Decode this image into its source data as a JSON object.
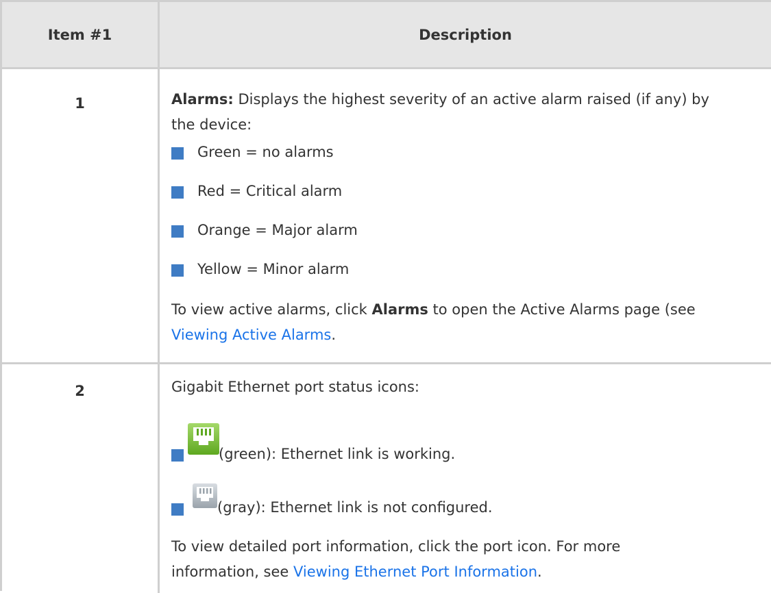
{
  "table": {
    "headers": [
      "Item #1",
      "Description"
    ],
    "rows": [
      {
        "item": "1",
        "intro_bold": "Alarms:",
        "intro_line1": " Displays the highest severity of an active alarm raised (if any) by",
        "intro_line2": "the device:",
        "bullets": [
          "Green = no alarms",
          "Red = Critical alarm",
          "Orange = Major alarm",
          "Yellow = Minor alarm"
        ],
        "outro_pre": "To view active alarms, click ",
        "outro_bold": "Alarms",
        "outro_post": " to open the Active Alarms page (see",
        "outro_link": "Viewing Active Alarms",
        "outro_end": "."
      },
      {
        "item": "2",
        "intro": "Gigabit Ethernet port status icons:",
        "bullets": [
          {
            "icon": "ethernet-port-green-icon",
            "text": "(green): Ethernet link is working."
          },
          {
            "icon": "ethernet-port-gray-icon",
            "text": "(gray): Ethernet link is not configured."
          }
        ],
        "outro_line1": "To view detailed port information, click the port icon. For more",
        "outro_pre": "information, see ",
        "outro_link": "Viewing Ethernet Port Information",
        "outro_end": "."
      }
    ]
  },
  "colors": {
    "header_bg": "#e6e6e6",
    "border": "#cfcfcf",
    "bullet": "#3f7cc4",
    "link": "#1a73e8"
  }
}
